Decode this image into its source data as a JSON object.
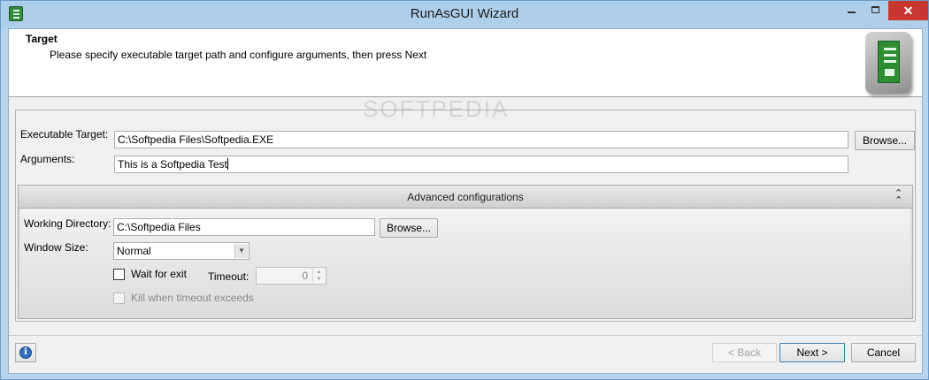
{
  "window": {
    "title": "RunAsGUI Wizard",
    "close_glyph": "✕"
  },
  "header": {
    "title": "Target",
    "subtitle": "Please specify executable target path and configure arguments, then press Next"
  },
  "form": {
    "executable_label": "Executable Target:",
    "executable_value": "C:\\Softpedia Files\\Softpedia.EXE",
    "browse_label": "Browse...",
    "arguments_label": "Arguments:",
    "arguments_value": "This is a Softpedia Test"
  },
  "advanced": {
    "title": "Advanced configurations",
    "collapse_glyph": "⌃",
    "working_dir_label": "Working Directory:",
    "working_dir_value": "C:\\Softpedia Files",
    "browse_label": "Browse...",
    "window_size_label": "Window Size:",
    "window_size_value": "Normal",
    "wait_for_exit_label": "Wait for exit",
    "wait_for_exit_checked": false,
    "timeout_label": "Timeout:",
    "timeout_value": "0",
    "kill_label": "Kill when timeout exceeds",
    "kill_checked": false
  },
  "footer": {
    "info_glyph": "i",
    "back_label": "< Back",
    "next_label": "Next >",
    "cancel_label": "Cancel"
  },
  "watermark": "SOFTPEDIA",
  "colors": {
    "title_bar": "#aecfeb",
    "close_button": "#c7372f",
    "logo_green": "#2e8d33"
  }
}
